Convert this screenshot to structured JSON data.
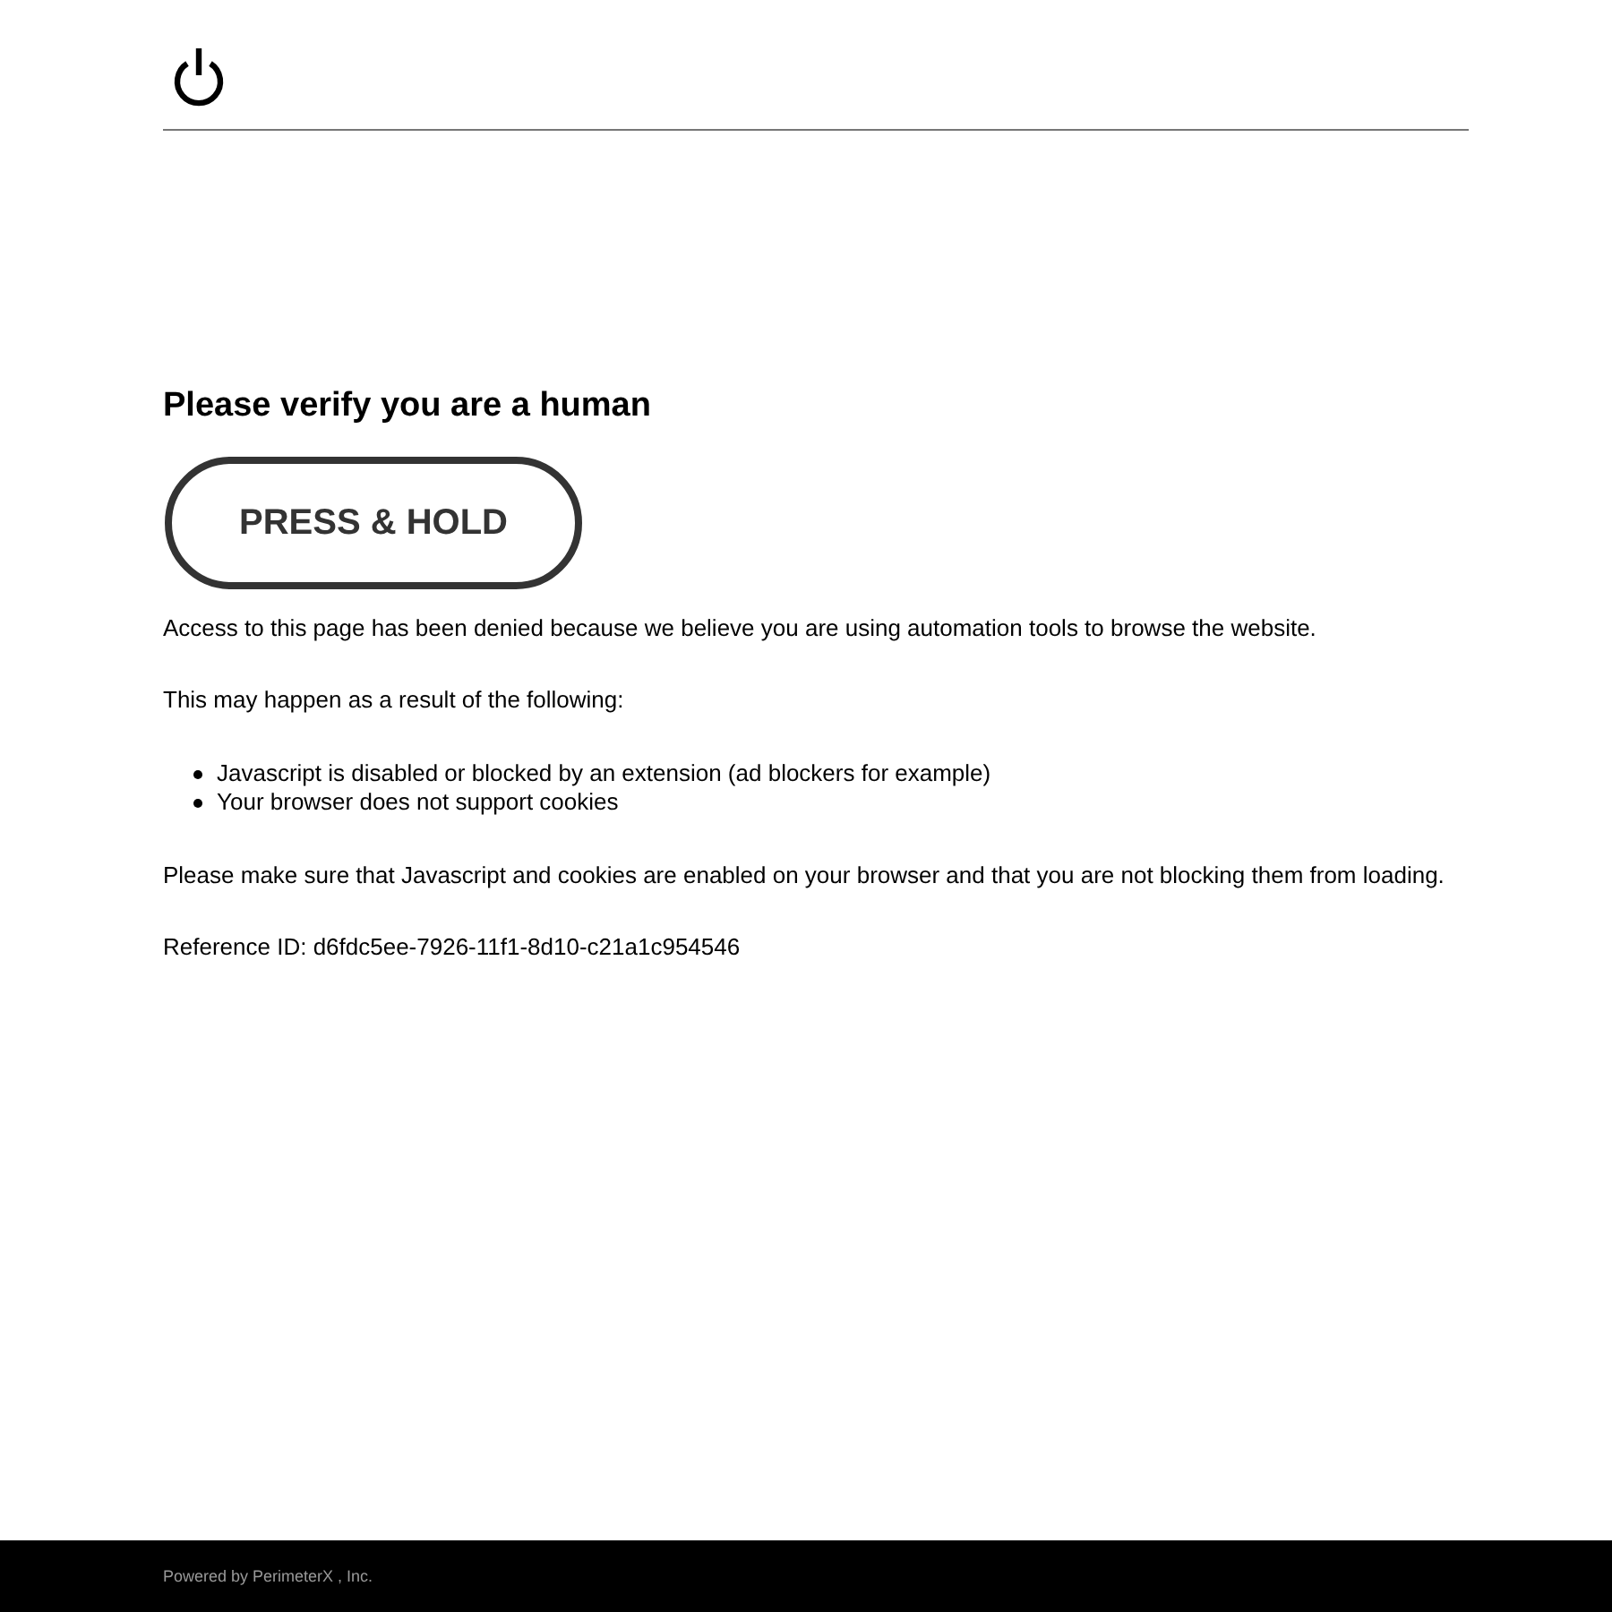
{
  "heading": "Please verify you are a human",
  "button": {
    "label": "PRESS & HOLD"
  },
  "message": "Access to this page has been denied because we believe you are using automation tools to browse the website.",
  "reasons_intro": "This may happen as a result of the following:",
  "reasons": [
    "Javascript is disabled or blocked by an extension (ad blockers for example)",
    "Your browser does not support cookies"
  ],
  "advice": "Please make sure that Javascript and cookies are enabled on your browser and that you are not blocking them from loading.",
  "reference": "Reference ID: d6fdc5ee-7926-11f1-8d10-c21a1c954546",
  "footer": {
    "text": "Powered by PerimeterX , Inc."
  }
}
